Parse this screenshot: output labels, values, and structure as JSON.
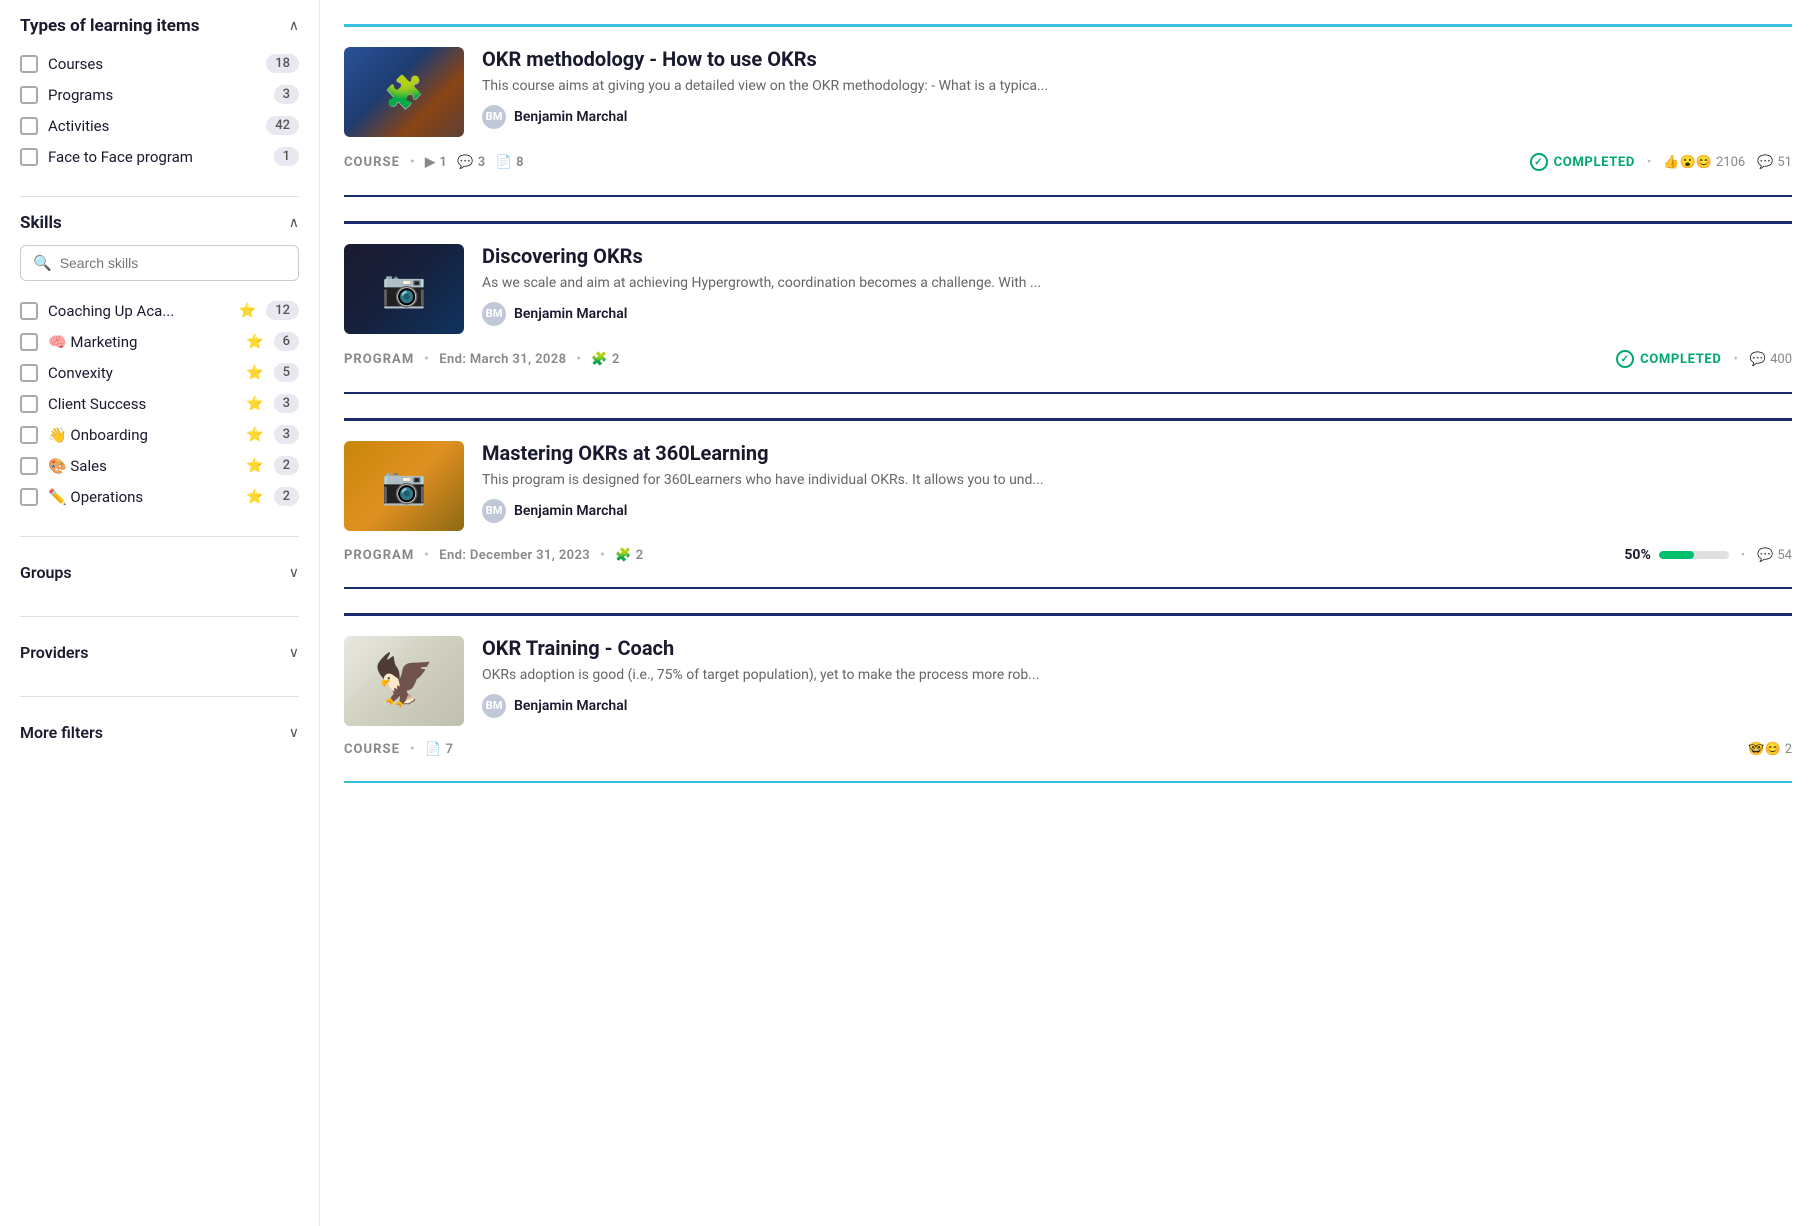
{
  "sidebar": {
    "learning_types_title": "Types of learning items",
    "items": [
      {
        "label": "Courses",
        "count": "18"
      },
      {
        "label": "Programs",
        "count": "3"
      },
      {
        "label": "Activities",
        "count": "42"
      },
      {
        "label": "Face to Face program",
        "count": "1"
      }
    ],
    "skills_title": "Skills",
    "search_placeholder": "Search skills",
    "skills": [
      {
        "label": "Coaching Up Aca...",
        "star": "⭐",
        "count": "12"
      },
      {
        "label": "🧠 Marketing",
        "star": "⭐",
        "count": "6"
      },
      {
        "label": "Convexity",
        "star": "⭐",
        "count": "5"
      },
      {
        "label": "Client Success",
        "star": "⭐",
        "count": "3"
      },
      {
        "label": "👋 Onboarding",
        "star": "⭐",
        "count": "3"
      },
      {
        "label": "🎨 Sales",
        "star": "⭐",
        "count": "2"
      },
      {
        "label": "✏️ Operations",
        "star": "⭐",
        "count": "2"
      }
    ],
    "groups_title": "Groups",
    "providers_title": "Providers",
    "more_filters_title": "More filters"
  },
  "cards": [
    {
      "id": 1,
      "title": "OKR methodology - How to use OKRs",
      "description": "This course aims at giving you a detailed view on the OKR methodology: - What is a typica...",
      "author": "Benjamin Marchal",
      "type": "COURSE",
      "meta": [
        {
          "icon": "▶",
          "value": "1"
        },
        {
          "icon": "💬",
          "value": "3"
        },
        {
          "icon": "📄",
          "value": "8"
        }
      ],
      "status": "COMPLETED",
      "reactions": "👍😮😊",
      "reaction_count": "2106",
      "comments": "51",
      "thumbnail_type": "puzzle"
    },
    {
      "id": 2,
      "title": "Discovering OKRs",
      "description": "As we scale and aim at achieving Hypergrowth, coordination becomes a challenge. With ...",
      "author": "Benjamin Marchal",
      "type": "PROGRAM",
      "end_date": "End: March 31, 2028",
      "puzzle_count": "2",
      "status": "COMPLETED",
      "comments": "400",
      "thumbnail_type": "camera"
    },
    {
      "id": 3,
      "title": "Mastering OKRs at 360Learning",
      "description": "This program is designed for 360Learners who have individual OKRs. It allows you to und...",
      "author": "Benjamin Marchal",
      "type": "PROGRAM",
      "end_date": "End: December 31, 2023",
      "puzzle_count": "2",
      "progress_pct": "50%",
      "progress_value": 50,
      "comments": "54",
      "thumbnail_type": "camera2"
    },
    {
      "id": 4,
      "title": "OKR Training - Coach",
      "description": "OKRs adoption is good (i.e., 75% of target population), yet to make the process more rob...",
      "author": "Benjamin Marchal",
      "type": "COURSE",
      "meta": [
        {
          "icon": "📄",
          "value": "7"
        }
      ],
      "reactions": "🤓😊",
      "reaction_count": "2",
      "thumbnail_type": "eagle"
    }
  ],
  "icons": {
    "chevron_up": "∧",
    "chevron_down": "∨",
    "search": "🔍",
    "check": "✓",
    "comment": "💬",
    "users": "👤"
  }
}
